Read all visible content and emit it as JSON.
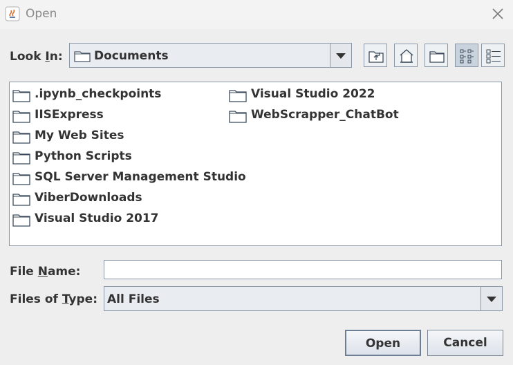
{
  "window": {
    "title": "Open"
  },
  "look_in": {
    "label_pre": "Look ",
    "label_key": "I",
    "label_post": "n:",
    "value": "Documents"
  },
  "toolbar": {
    "buttons": [
      {
        "name": "up-one-level-button",
        "icon": "folder-up-icon"
      },
      {
        "name": "home-button",
        "icon": "home-icon"
      },
      {
        "name": "new-folder-button",
        "icon": "new-folder-icon"
      },
      {
        "name": "list-view-button",
        "icon": "list-view-icon",
        "selected": true
      },
      {
        "name": "details-view-button",
        "icon": "details-view-icon"
      }
    ]
  },
  "files": {
    "col1": [
      ".ipynb_checkpoints",
      "IISExpress",
      "My Web Sites",
      "Python Scripts",
      "SQL Server Management Studio",
      "ViberDownloads",
      "Visual Studio 2017"
    ],
    "col2": [
      "Visual Studio 2022",
      "WebScrapper_ChatBot"
    ]
  },
  "file_name": {
    "label_pre": "File ",
    "label_key": "N",
    "label_post": "ame:",
    "value": ""
  },
  "file_type": {
    "label_pre": "Files of ",
    "label_key": "T",
    "label_post": "ype:",
    "value": "All Files"
  },
  "buttons": {
    "open": "Open",
    "cancel": "Cancel"
  },
  "colors": {
    "background": "#eeeeee",
    "border": "#8a97a6",
    "selected_toggle": "#c9d3de"
  }
}
